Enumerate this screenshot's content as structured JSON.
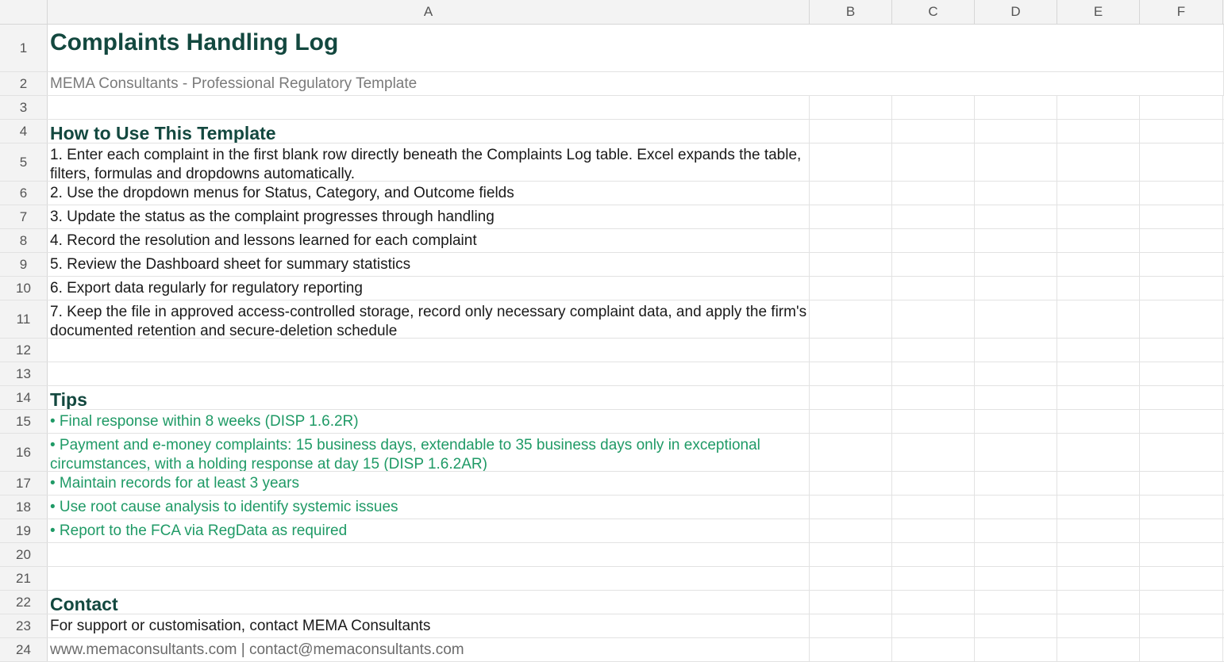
{
  "columns": [
    "A",
    "B",
    "C",
    "D",
    "E",
    "F"
  ],
  "rows": [
    {
      "num": "1",
      "text": "Complaints Handling Log"
    },
    {
      "num": "2",
      "text": "MEMA Consultants - Professional Regulatory Template"
    },
    {
      "num": "3",
      "text": ""
    },
    {
      "num": "4",
      "text": "How to Use This Template"
    },
    {
      "num": "5",
      "text": "1. Enter each complaint in the first blank row directly beneath the Complaints Log table. Excel expands the table, filters, formulas and dropdowns automatically."
    },
    {
      "num": "6",
      "text": "2. Use the dropdown menus for Status, Category, and Outcome fields"
    },
    {
      "num": "7",
      "text": "3. Update the status as the complaint progresses through handling"
    },
    {
      "num": "8",
      "text": "4. Record the resolution and lessons learned for each complaint"
    },
    {
      "num": "9",
      "text": "5. Review the Dashboard sheet for summary statistics"
    },
    {
      "num": "10",
      "text": "6. Export data regularly for regulatory reporting"
    },
    {
      "num": "11",
      "text": "7. Keep the file in approved access-controlled storage, record only necessary complaint data, and apply the firm's documented retention and secure-deletion schedule"
    },
    {
      "num": "12",
      "text": ""
    },
    {
      "num": "13",
      "text": ""
    },
    {
      "num": "14",
      "text": "Tips"
    },
    {
      "num": "15",
      "text": "• Final response within 8 weeks (DISP 1.6.2R)"
    },
    {
      "num": "16",
      "text": "• Payment and e-money complaints: 15 business days, extendable to 35 business days only in exceptional circumstances, with a holding response at day 15 (DISP 1.6.2AR)"
    },
    {
      "num": "17",
      "text": "• Maintain records for at least 3 years"
    },
    {
      "num": "18",
      "text": "• Use root cause analysis to identify systemic issues"
    },
    {
      "num": "19",
      "text": "• Report to the FCA via RegData as required"
    },
    {
      "num": "20",
      "text": ""
    },
    {
      "num": "21",
      "text": ""
    },
    {
      "num": "22",
      "text": "Contact"
    },
    {
      "num": "23",
      "text": "For support or customisation, contact MEMA Consultants"
    },
    {
      "num": "24",
      "text": "www.memaconsultants.com | contact@memaconsultants.com"
    }
  ],
  "colors": {
    "heading": "#13483f",
    "tip": "#1f9a66",
    "muted": "#7a7a7a"
  }
}
